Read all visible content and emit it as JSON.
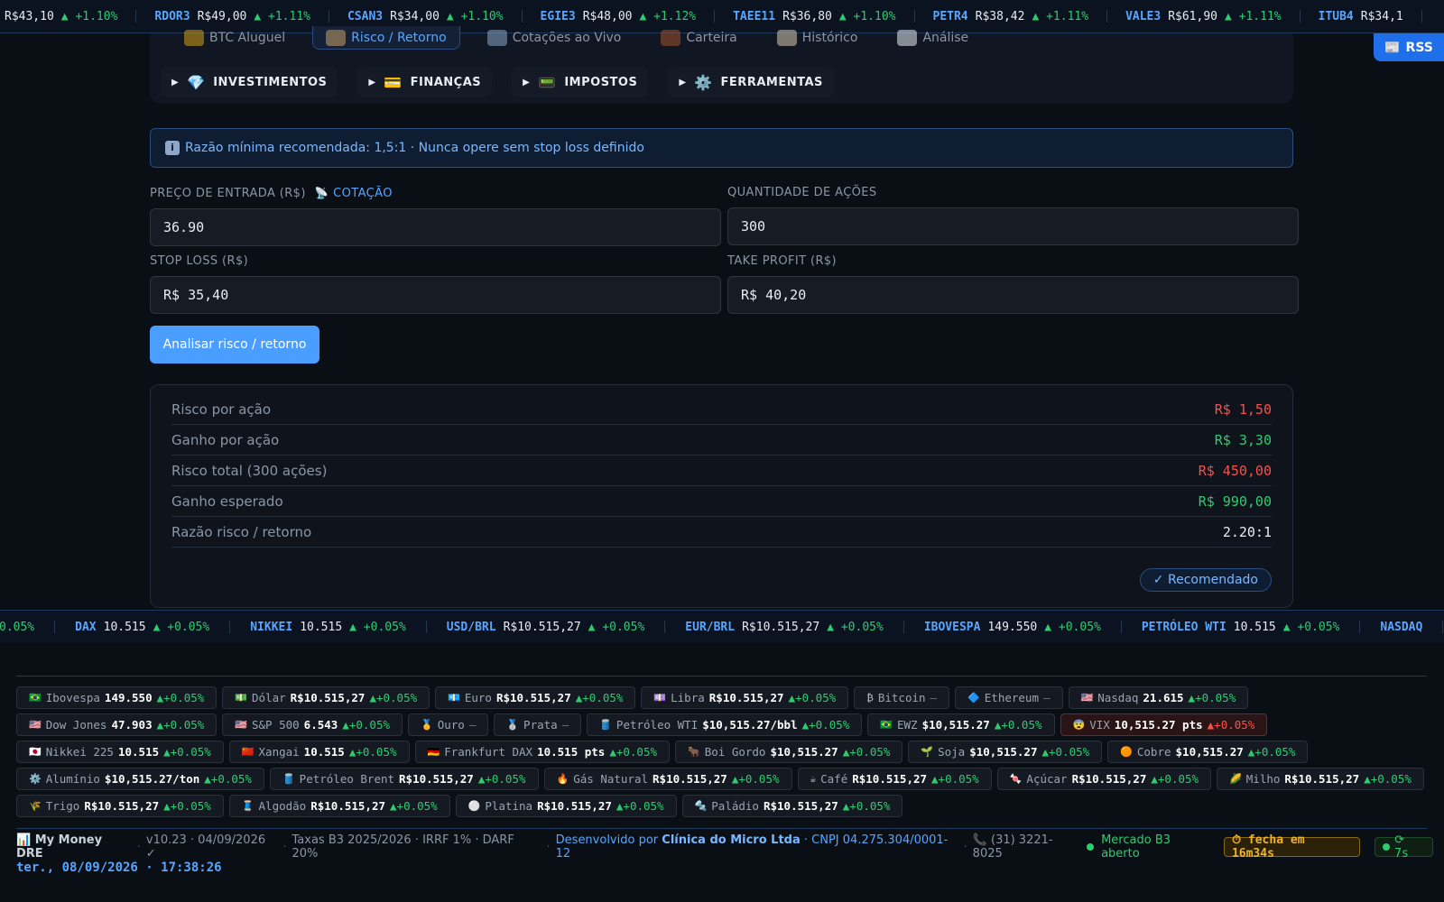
{
  "ticker_top": [
    {
      "sym": "",
      "price": "R$43,10",
      "chg": "▲ +1.10%"
    },
    {
      "sym": "RDOR3",
      "price": "R$49,00",
      "chg": "▲ +1.11%"
    },
    {
      "sym": "CSAN3",
      "price": "R$34,00",
      "chg": "▲ +1.10%"
    },
    {
      "sym": "EGIE3",
      "price": "R$48,00",
      "chg": "▲ +1.12%"
    },
    {
      "sym": "TAEE11",
      "price": "R$36,80",
      "chg": "▲ +1.10%"
    },
    {
      "sym": "PETR4",
      "price": "R$38,42",
      "chg": "▲ +1.11%"
    },
    {
      "sym": "VALE3",
      "price": "R$61,90",
      "chg": "▲ +1.11%"
    },
    {
      "sym": "ITUB4",
      "price": "R$34,1",
      "chg": ""
    }
  ],
  "subtabs": [
    {
      "label": "BTC Aluguel",
      "icon": "handshake-icon",
      "color": "#d4a017"
    },
    {
      "label": "Risco / Retorno",
      "icon": "scales-icon",
      "color": "#c9a36b"
    },
    {
      "label": "Cotações ao Vivo",
      "icon": "satellite-icon",
      "color": "#8aa6c8"
    },
    {
      "label": "Carteira",
      "icon": "briefcase-icon",
      "color": "#a0522d"
    },
    {
      "label": "Histórico",
      "icon": "clipboard-icon",
      "color": "#d9cbb0"
    },
    {
      "label": "Análise",
      "icon": "chart-up-icon",
      "color": "#e6edf3"
    }
  ],
  "categories": [
    {
      "label": "INVESTIMENTOS",
      "icon": "💎"
    },
    {
      "label": "FINANÇAS",
      "icon": "💳"
    },
    {
      "label": "IMPOSTOS",
      "icon": "📟"
    },
    {
      "label": "FERRAMENTAS",
      "icon": "⚙️"
    }
  ],
  "rss_label": "RSS",
  "info_text": "Razão mínima recomendada: 1,5:1 · Nunca opere sem stop loss definido",
  "form": {
    "entry_label": "PREÇO DE ENTRADA (R$)",
    "quote_label": "COTAÇÃO",
    "entry_value": "36.90",
    "qty_label": "QUANTIDADE DE AÇÕES",
    "qty_value": "300",
    "stop_label": "STOP LOSS (R$)",
    "stop_value": "R$ 35,40",
    "take_label": "TAKE PROFIT (R$)",
    "take_value": "R$ 40,20",
    "submit_label": "Analisar risco / retorno"
  },
  "results": [
    {
      "key": "Risco por ação",
      "value": "R$ 1,50",
      "tone": "red"
    },
    {
      "key": "Ganho por ação",
      "value": "R$ 3,30",
      "tone": "green"
    },
    {
      "key": "Risco total (300 ações)",
      "value": "R$ 450,00",
      "tone": "red"
    },
    {
      "key": "Ganho esperado",
      "value": "R$ 990,00",
      "tone": "green"
    },
    {
      "key": "Razão risco / retorno",
      "value": "2.20:1",
      "tone": "white"
    }
  ],
  "recommended_badge": "✓ Recomendado",
  "ticker_bottom": [
    {
      "sym": "",
      "price": "",
      "chg": "0.05%"
    },
    {
      "sym": "DAX",
      "price": "10.515",
      "chg": "▲ +0.05%"
    },
    {
      "sym": "NIKKEI",
      "price": "10.515",
      "chg": "▲ +0.05%"
    },
    {
      "sym": "USD/BRL",
      "price": "R$10.515,27",
      "chg": "▲ +0.05%"
    },
    {
      "sym": "EUR/BRL",
      "price": "R$10.515,27",
      "chg": "▲ +0.05%"
    },
    {
      "sym": "IBOVESPA",
      "price": "149.550",
      "chg": "▲ +0.05%"
    },
    {
      "sym": "PETRÓLEO WTI",
      "price": "10.515",
      "chg": "▲ +0.05%"
    },
    {
      "sym": "NASDAQ",
      "price": "",
      "chg": ""
    }
  ],
  "chips": [
    {
      "flag": "🇧🇷",
      "name": "Ibovespa",
      "value": "149.550",
      "chg": "▲+0.05%"
    },
    {
      "flag": "💵",
      "name": "Dólar",
      "value": "R$10.515,27",
      "chg": "▲+0.05%"
    },
    {
      "flag": "💶",
      "name": "Euro",
      "value": "R$10.515,27",
      "chg": "▲+0.05%"
    },
    {
      "flag": "💷",
      "name": "Libra",
      "value": "R$10.515,27",
      "chg": "▲+0.05%"
    },
    {
      "flag": "₿",
      "name": "Bitcoin",
      "value": "",
      "chg": "—"
    },
    {
      "flag": "🔷",
      "name": "Ethereum",
      "value": "",
      "chg": "—"
    },
    {
      "flag": "🇺🇸",
      "name": "Nasdaq",
      "value": "21.615",
      "chg": "▲+0.05%"
    },
    {
      "flag": "🇺🇸",
      "name": "Dow Jones",
      "value": "47.903",
      "chg": "▲+0.05%"
    },
    {
      "flag": "🇺🇸",
      "name": "S&P 500",
      "value": "6.543",
      "chg": "▲+0.05%"
    },
    {
      "flag": "🥇",
      "name": "Ouro",
      "value": "",
      "chg": "—"
    },
    {
      "flag": "🥈",
      "name": "Prata",
      "value": "",
      "chg": "—"
    },
    {
      "flag": "🛢️",
      "name": "Petróleo WTI",
      "value": "$10,515.27/bbl",
      "chg": "▲+0.05%"
    },
    {
      "flag": "🇧🇷",
      "name": "EWZ",
      "value": "$10,515.27",
      "chg": "▲+0.05%"
    },
    {
      "flag": "😨",
      "name": "VIX",
      "value": "10,515.27 pts",
      "chg": "▲+0.05%",
      "vix": true
    },
    {
      "flag": "🇯🇵",
      "name": "Nikkei 225",
      "value": "10.515",
      "chg": "▲+0.05%"
    },
    {
      "flag": "🇨🇳",
      "name": "Xangai",
      "value": "10.515",
      "chg": "▲+0.05%"
    },
    {
      "flag": "🇩🇪",
      "name": "Frankfurt DAX",
      "value": "10.515 pts",
      "chg": "▲+0.05%"
    },
    {
      "flag": "🐂",
      "name": "Boi Gordo",
      "value": "$10,515.27",
      "chg": "▲+0.05%"
    },
    {
      "flag": "🌱",
      "name": "Soja",
      "value": "$10,515.27",
      "chg": "▲+0.05%"
    },
    {
      "flag": "🟠",
      "name": "Cobre",
      "value": "$10,515.27",
      "chg": "▲+0.05%"
    },
    {
      "flag": "⚙️",
      "name": "Alumínio",
      "value": "$10,515.27/ton",
      "chg": "▲+0.05%"
    },
    {
      "flag": "🛢️",
      "name": "Petróleo Brent",
      "value": "R$10.515,27",
      "chg": "▲+0.05%"
    },
    {
      "flag": "🔥",
      "name": "Gás Natural",
      "value": "R$10.515,27",
      "chg": "▲+0.05%"
    },
    {
      "flag": "☕",
      "name": "Café",
      "value": "R$10.515,27",
      "chg": "▲+0.05%"
    },
    {
      "flag": "🍬",
      "name": "Açúcar",
      "value": "R$10.515,27",
      "chg": "▲+0.05%"
    },
    {
      "flag": "🌽",
      "name": "Milho",
      "value": "R$10.515,27",
      "chg": "▲+0.05%"
    },
    {
      "flag": "🌾",
      "name": "Trigo",
      "value": "R$10.515,27",
      "chg": "▲+0.05%"
    },
    {
      "flag": "🧵",
      "name": "Algodão",
      "value": "R$10.515,27",
      "chg": "▲+0.05%"
    },
    {
      "flag": "⚪",
      "name": "Platina",
      "value": "R$10.515,27",
      "chg": "▲+0.05%"
    },
    {
      "flag": "🔩",
      "name": "Paládio",
      "value": "R$10.515,27",
      "chg": "▲+0.05%"
    }
  ],
  "footer": {
    "brand": "📊 My Money DRE",
    "version": "v10.23 · 04/09/2026 ✓",
    "taxes": "Taxas B3 2025/2026 · IRRF 1% · DARF 20%",
    "dev_prefix": "Desenvolvido por",
    "dev_name": "Clínica do Micro Ltda",
    "cnpj": "· CNPJ 04.275.304/0001-12",
    "phone": "📞 (31) 3221-8025",
    "market_status": "Mercado B3 aberto",
    "closes_in": "⏱ fecha em 16m34s",
    "refresh": "⟳ 7s",
    "datetime": "ter., 08/09/2026 · 17:38:26"
  },
  "colors": {
    "accent": "#58a6ff",
    "positive": "#2ecc71",
    "negative": "#f85149",
    "background": "#0a0e15"
  }
}
